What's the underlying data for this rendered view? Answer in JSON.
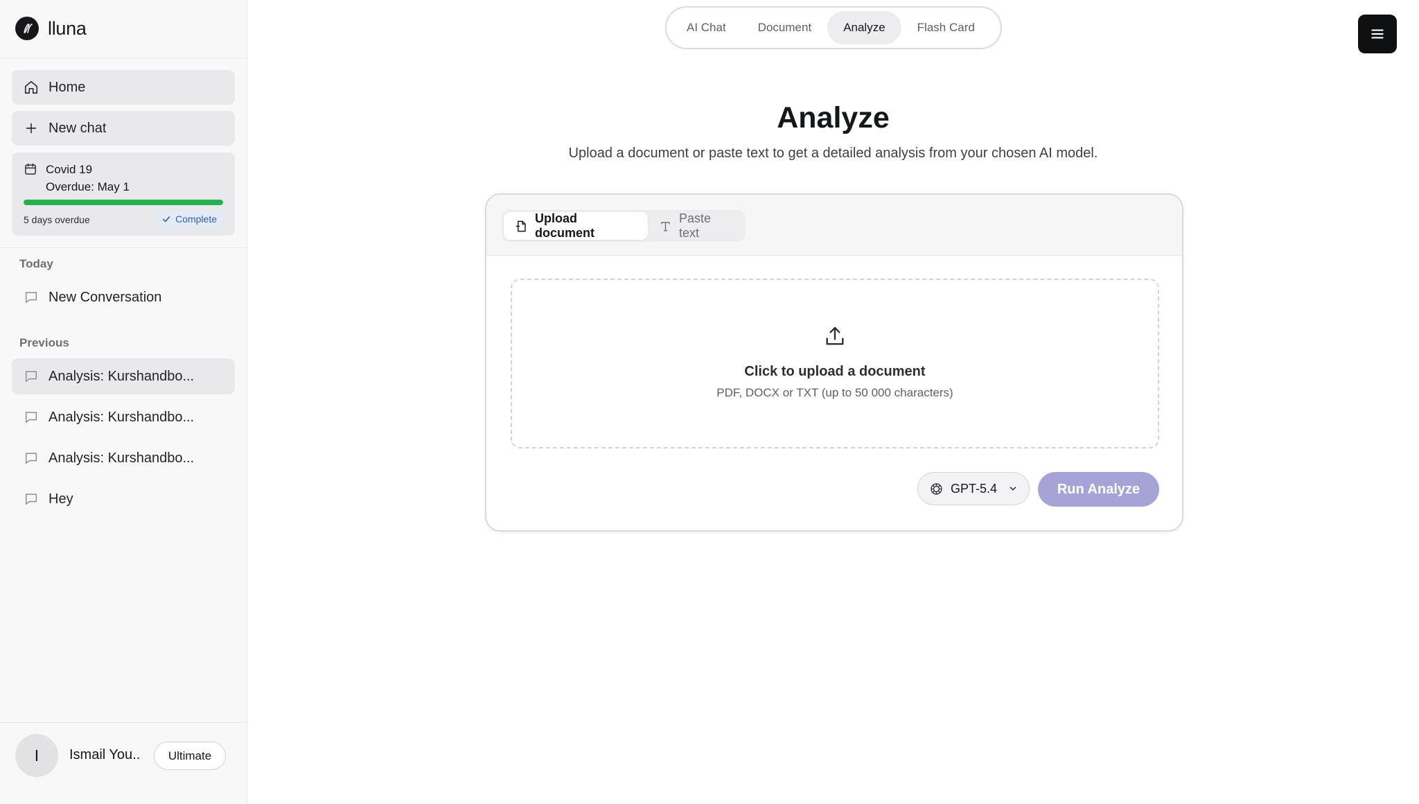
{
  "brand": {
    "name": "lluna",
    "logo_icon": "brand-logo-icon"
  },
  "sidebar": {
    "home_label": "Home",
    "new_chat_label": "New chat",
    "task": {
      "title": "Covid 19",
      "due": "Overdue: May 1",
      "progress": 1.0,
      "status": "5 days overdue",
      "complete_label": "Complete"
    },
    "today_label": "Today",
    "today_items": [
      {
        "label": "New Conversation"
      }
    ],
    "previous_label": "Previous",
    "previous_items": [
      {
        "label": "Analysis: Kurshandbo..."
      },
      {
        "label": "Analysis: Kurshandbo..."
      },
      {
        "label": "Analysis: Kurshandbo..."
      },
      {
        "label": "Hey"
      }
    ],
    "user": {
      "initial": "I",
      "name": "Ismail You..",
      "plan": "Ultimate"
    }
  },
  "top_tabs": [
    {
      "label": "AI Chat"
    },
    {
      "label": "Document"
    },
    {
      "label": "Analyze"
    },
    {
      "label": "Flash Card"
    }
  ],
  "main": {
    "title": "Analyze",
    "subtitle": "Upload a document or paste text to get a detailed analysis from your chosen AI model.",
    "mode_tabs": [
      {
        "label": "Upload document",
        "icon": "document-icon"
      },
      {
        "label": "Paste text",
        "icon": "text-icon"
      }
    ],
    "dropzone": {
      "title": "Click to upload a document",
      "hint": "PDF, DOCX or TXT (up to 50 000 characters)"
    },
    "model": {
      "selected": "GPT-5.4"
    },
    "run_label": "Run Analyze"
  },
  "colors": {
    "accent_button": "#a6a3d6",
    "progress_fill": "#22b14c",
    "complete_badge_text": "#2f5fb3",
    "menu_button": "#0f1012"
  }
}
